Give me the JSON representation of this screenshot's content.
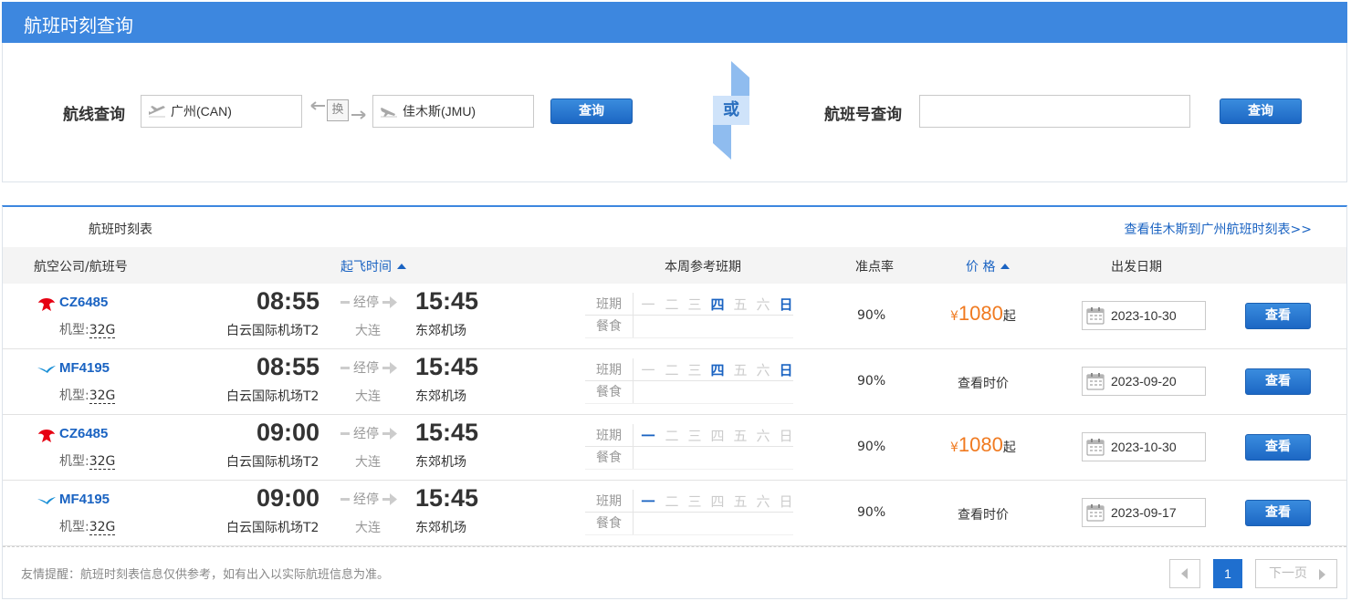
{
  "header": {
    "title": "航班时刻查询"
  },
  "route_search": {
    "label": "航线查询",
    "from_value": "广州(CAN)",
    "to_value": "佳木斯(JMU)",
    "swap_label": "换",
    "query_label": "查询"
  },
  "or_label": "或",
  "flight_search": {
    "label": "航班号查询",
    "value": "",
    "query_label": "查询"
  },
  "timetable": {
    "title": "航班时刻表",
    "reverse_link": "查看佳木斯到广州航班时刻表>>",
    "columns": {
      "airline": "航空公司/航班号",
      "dep_time": "起飞时间",
      "schedule": "本周参考班期",
      "ontime": "准点率",
      "price": "价 格",
      "date": "出发日期"
    },
    "schedule_labels": {
      "days_row": "班期",
      "meal_row": "餐食"
    },
    "weekdays": [
      "一",
      "二",
      "三",
      "四",
      "五",
      "六",
      "日"
    ],
    "aircraft_prefix": "机型:",
    "view_label": "查看",
    "rows": [
      {
        "airline_icon": "china-southern-logo",
        "flight_no": "CZ6485",
        "aircraft": "32G",
        "dep_time": "08:55",
        "dep_airport": "白云国际机场T2",
        "stop_label": "经停",
        "stop_city": "大连",
        "arr_time": "15:45",
        "arr_airport": "东郊机场",
        "days_active": [
          false,
          false,
          false,
          true,
          false,
          false,
          true
        ],
        "ontime": "90%",
        "price_prefix": "¥",
        "price_value": "1080",
        "price_suffix": "起",
        "price_text": "",
        "date": "2023-10-30"
      },
      {
        "airline_icon": "xiamen-air-logo",
        "flight_no": "MF4195",
        "aircraft": "32G",
        "dep_time": "08:55",
        "dep_airport": "白云国际机场T2",
        "stop_label": "经停",
        "stop_city": "大连",
        "arr_time": "15:45",
        "arr_airport": "东郊机场",
        "days_active": [
          false,
          false,
          false,
          true,
          false,
          false,
          true
        ],
        "ontime": "90%",
        "price_prefix": "",
        "price_value": "",
        "price_suffix": "",
        "price_text": "查看时价",
        "date": "2023-09-20"
      },
      {
        "airline_icon": "china-southern-logo",
        "flight_no": "CZ6485",
        "aircraft": "32G",
        "dep_time": "09:00",
        "dep_airport": "白云国际机场T2",
        "stop_label": "经停",
        "stop_city": "大连",
        "arr_time": "15:45",
        "arr_airport": "东郊机场",
        "days_active": [
          true,
          false,
          false,
          false,
          false,
          false,
          false
        ],
        "ontime": "90%",
        "price_prefix": "¥",
        "price_value": "1080",
        "price_suffix": "起",
        "price_text": "",
        "date": "2023-10-30"
      },
      {
        "airline_icon": "xiamen-air-logo",
        "flight_no": "MF4195",
        "aircraft": "32G",
        "dep_time": "09:00",
        "dep_airport": "白云国际机场T2",
        "stop_label": "经停",
        "stop_city": "大连",
        "arr_time": "15:45",
        "arr_airport": "东郊机场",
        "days_active": [
          true,
          false,
          false,
          false,
          false,
          false,
          false
        ],
        "ontime": "90%",
        "price_prefix": "",
        "price_value": "",
        "price_suffix": "",
        "price_text": "查看时价",
        "date": "2023-09-17"
      }
    ]
  },
  "footer": {
    "note": "友情提醒：航班时刻表信息仅供参考，如有出入以实际航班信息为准。",
    "page_current": "1",
    "next_label": "下一页"
  },
  "colors": {
    "header_blue": "#3d87df",
    "link_blue": "#1a63c2",
    "price_orange": "#f07a20",
    "china_southern_red": "#e60012",
    "xiamen_air_blue": "#1a8fd6"
  }
}
